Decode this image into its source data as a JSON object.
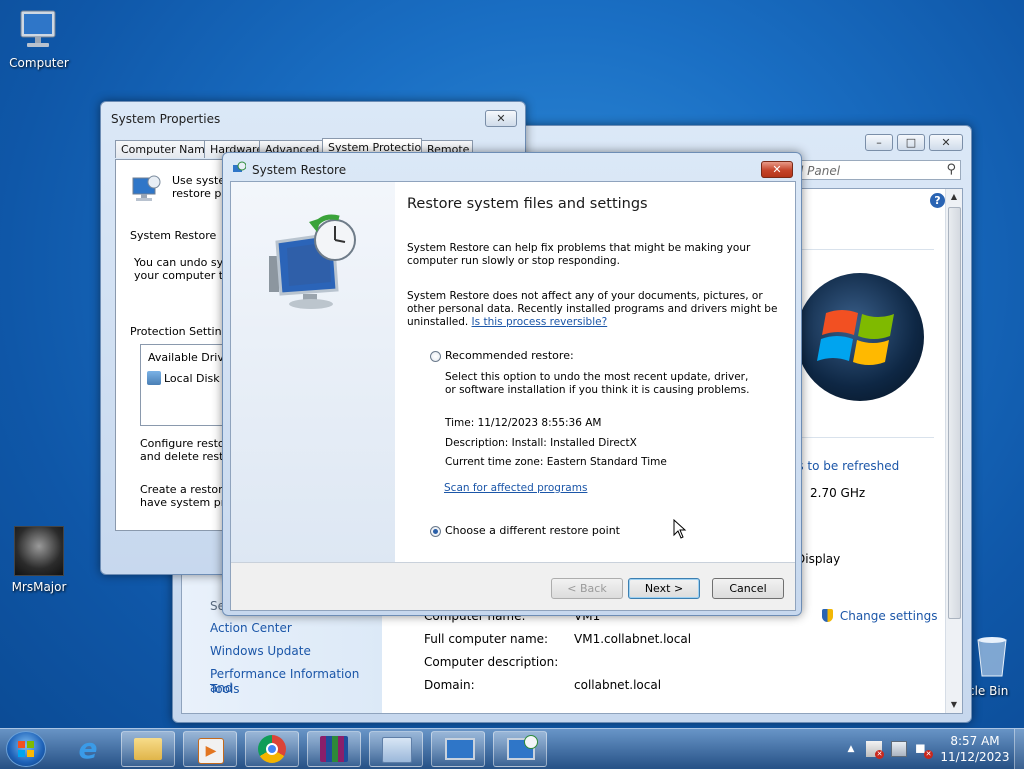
{
  "desktop": {
    "icons": [
      {
        "label": "Computer",
        "icon": "computer-icon"
      },
      {
        "label": "MrsMajor",
        "icon": "mrsmajor-icon"
      },
      {
        "label": "cle Bin",
        "icon": "recycle-bin-icon"
      }
    ]
  },
  "control_panel": {
    "search_placeholder": "l Panel",
    "help_glyph": "?",
    "right_text": {
      "refresh_link": "ls to be refreshed",
      "cpu_speed": "2.70 GHz",
      "display": "Display"
    },
    "see_also_partial": "Se",
    "left_links": [
      "Action Center",
      "Windows Update",
      "Performance Information and",
      "Tools"
    ],
    "details": [
      {
        "label": "Computer name:",
        "value": "VM1"
      },
      {
        "label": "Full computer name:",
        "value": "VM1.collabnet.local"
      },
      {
        "label": "Computer description:",
        "value": ""
      },
      {
        "label": "Domain:",
        "value": "collabnet.local"
      }
    ],
    "change_settings": "Change settings"
  },
  "system_properties": {
    "title": "System Properties",
    "tabs": [
      "Computer Name",
      "Hardware",
      "Advanced",
      "System Protection",
      "Remote"
    ],
    "intro_lines": [
      "Use system",
      "restore pre"
    ],
    "system_restore_label": "System Restore",
    "undo_lines": [
      "You can undo syst",
      "your computer to a"
    ],
    "protection_settings_label": "Protection Settings",
    "drives_header": "Available Drives",
    "drive_item": "Local Disk (C",
    "configure_lines": [
      "Configure restore",
      "and delete restore"
    ],
    "create_lines": [
      "Create a restore p",
      "have system prote"
    ]
  },
  "system_restore": {
    "title": "System Restore",
    "heading": "Restore system files and settings",
    "para1": [
      "System Restore can help fix problems that might be making your",
      "computer run slowly or stop responding."
    ],
    "para2": [
      "System Restore does not affect any of your documents, pictures, or",
      "other personal data. Recently installed programs and drivers might be"
    ],
    "para2_last": "uninstalled.",
    "reversible_link": "Is this process reversible?",
    "recommended_label": "Recommended restore:",
    "recommended_desc": [
      "Select this option to undo the most recent update, driver,",
      "or software installation if you think it is causing problems."
    ],
    "time_line": "Time: 11/12/2023 8:55:36 AM",
    "description_line": "Description: Install: Installed DirectX",
    "timezone_line": "Current time zone: Eastern Standard Time",
    "scan_link": "Scan for affected programs",
    "different_label": "Choose a different restore point",
    "selected_option": "different",
    "back_label": "< Back",
    "next_label": "Next >",
    "cancel_label": "Cancel"
  },
  "taskbar": {
    "apps": [
      "start-orb",
      "internet-explorer-icon",
      "file-explorer-icon",
      "media-player-icon",
      "chrome-icon",
      "winrar-icon",
      "control-panel-icon",
      "system-icon",
      "system-restore-icon"
    ],
    "time": "8:57 AM",
    "date": "11/12/2023"
  }
}
